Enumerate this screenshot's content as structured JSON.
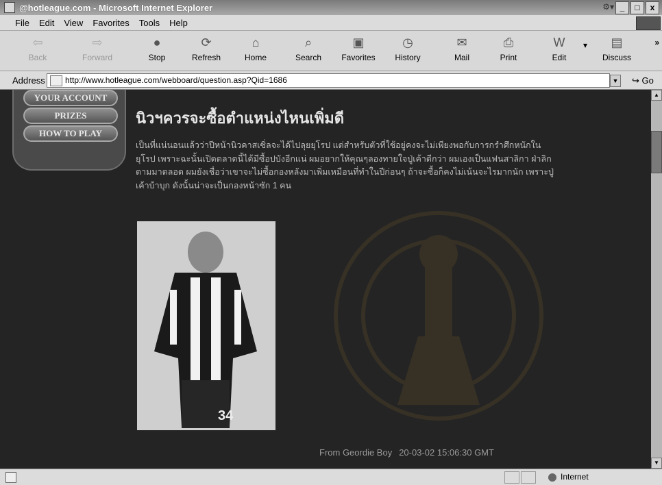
{
  "window": {
    "title": "@hotleague.com - Microsoft Internet Explorer",
    "buttons": [
      "_",
      "□",
      "x"
    ]
  },
  "menu": [
    "File",
    "Edit",
    "View",
    "Favorites",
    "Tools",
    "Help"
  ],
  "toolbar": {
    "back": "Back",
    "forward": "Forward",
    "stop": "Stop",
    "refresh": "Refresh",
    "home": "Home",
    "search": "Search",
    "favorites": "Favorites",
    "history": "History",
    "mail": "Mail",
    "print": "Print",
    "edit": "Edit",
    "discuss": "Discuss",
    "more": "»"
  },
  "address": {
    "label": "Address",
    "url": "http://www.hotleague.com/webboard/question.asp?Qid=1686",
    "go": "Go"
  },
  "nav": {
    "items": [
      "YOUR ACCOUNT",
      "PRIZES",
      "HOW TO PLAY"
    ]
  },
  "post": {
    "title": "นิวฯควรจะซื้อตำแหน่งไหนเพิ่มดี",
    "body": "เป็นที่แน่นอนแล้วว่าปีหน้านิวคาสเซิ่ลจะได้ไปลุยยุโรป แต่สำหรับตัวที่ใช้อยู่คงจะไม่เพียงพอกับการกรำศึกหนักในยุโรป เพราะฉะนั้นเปิดตลาดนี้ได้มีซื้อปบังอีกแน่ ผมอยากให้คุณๆลองทายใจปู่เค้าดีกว่า ผมเองเป็นแฟนสาลิกา ฝ่าลิกตามมาตลอด ผมยังเชื่อว่าเขาจะไม่ซื้อกองหลังมาเพิ่มเหมือนที่ทำในปีก่อนๆ ถ้าจะซื้อก็คงไม่เน้นจะไรมากนัก เพราะปู่เค้าบ้าบุก ดังนั้นน่าจะเป็นกองหน้าซัก 1 คน",
    "author": "From Geordie Boy",
    "date": "20-03-02 15:06:30 GMT"
  },
  "status": {
    "zone": "Internet"
  }
}
